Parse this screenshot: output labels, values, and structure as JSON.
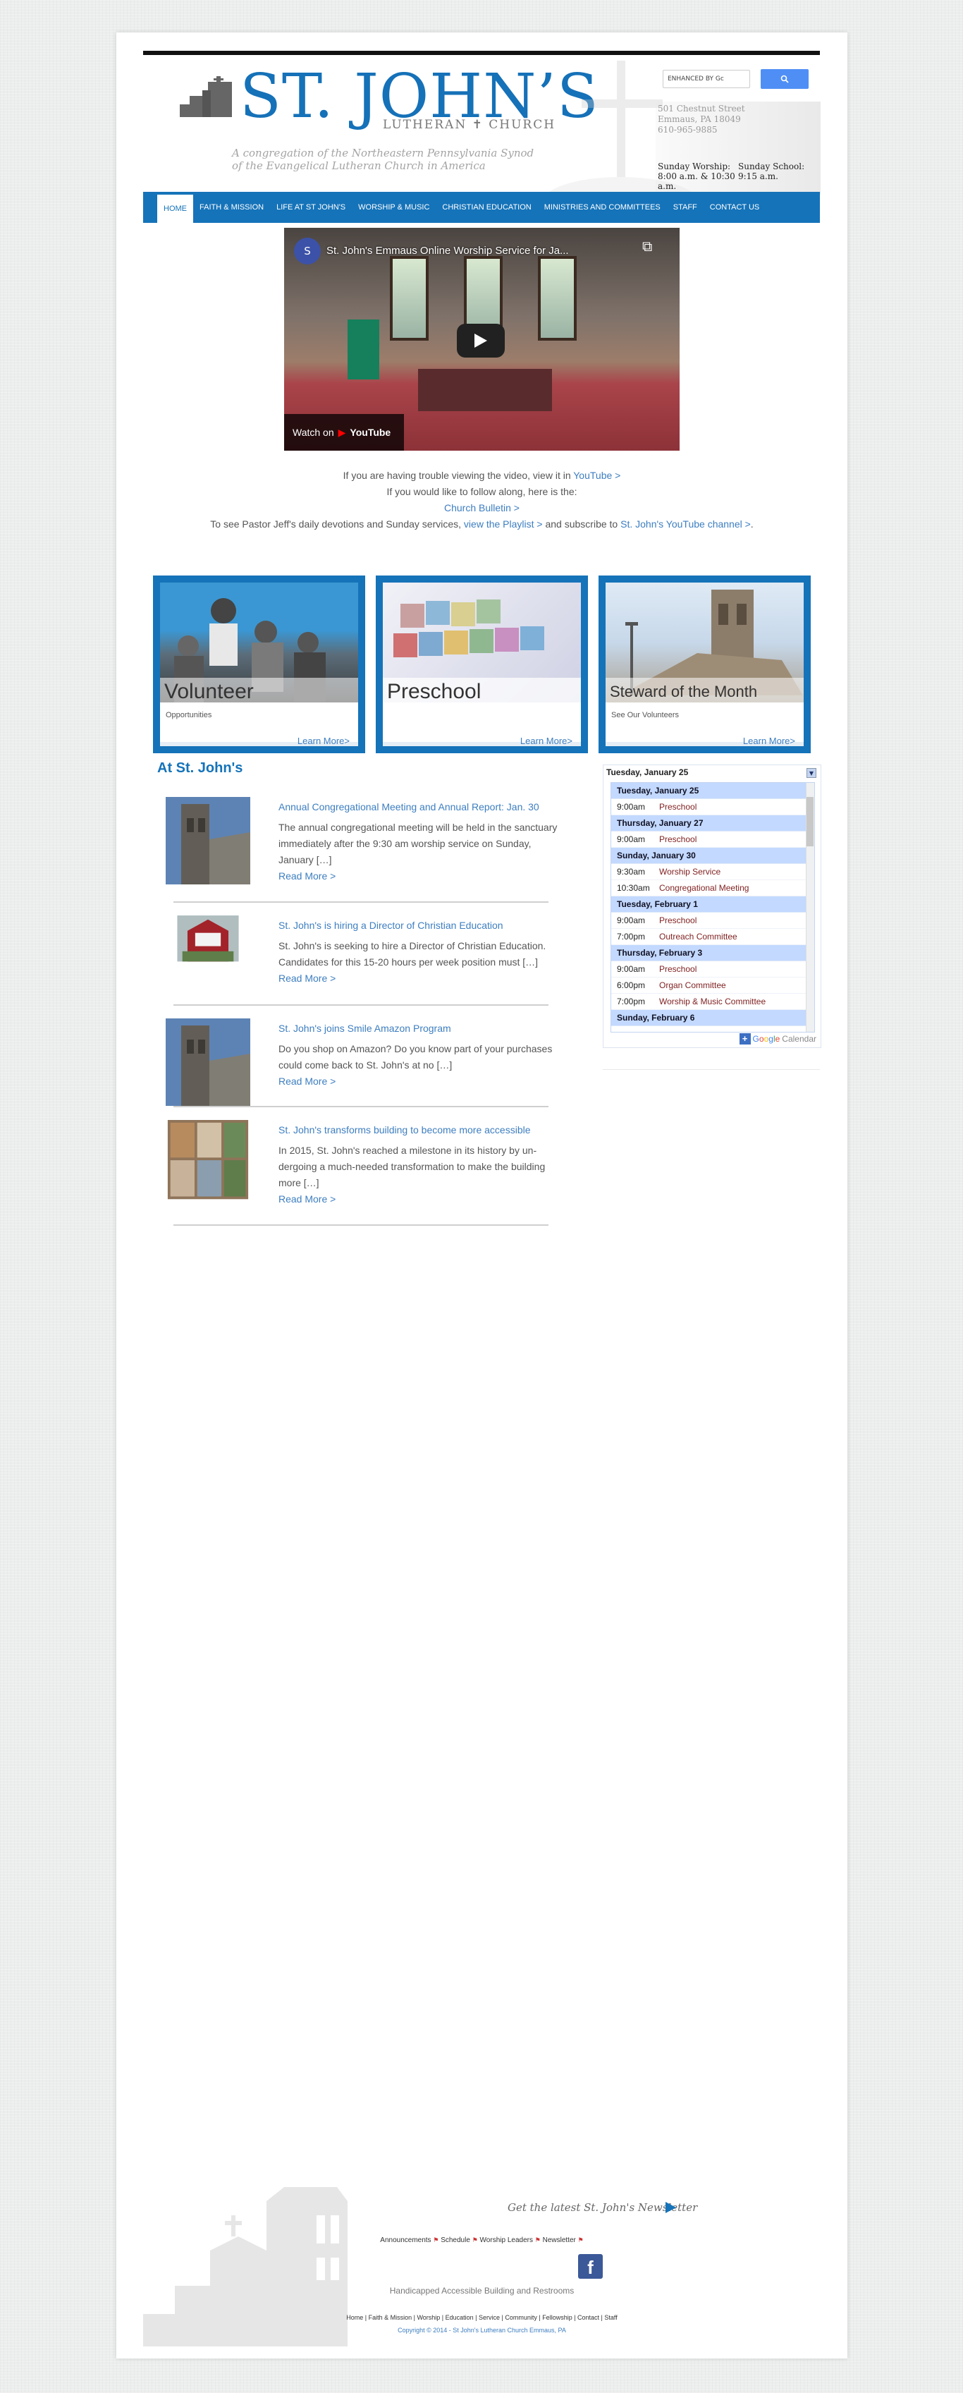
{
  "header": {
    "logo_name": "ST. JOHN’S",
    "logo_sub": "LUTHERAN ✝ CHURCH",
    "tagline": "A congregation of the Northeastern Pennsylvania Synod of the Evangelical Lutheran Church in America",
    "address": [
      "501 Chestnut Street",
      "Emmaus, PA 18049",
      "610-965-9885"
    ],
    "worship": [
      "Sunday Worship:",
      "8:00 a.m. & 10:30",
      "a.m."
    ],
    "school": [
      "Sunday School:",
      "9:15 a.m."
    ]
  },
  "search": {
    "placeholder": "ENHANCED BY Gc",
    "button_icon": "search-icon"
  },
  "nav": {
    "items": [
      "HOME",
      "FAITH & MISSION",
      "LIFE AT ST JOHN'S",
      "WORSHIP & MUSIC",
      "CHRISTIAN EDUCATION",
      "MINISTRIES AND COMMITTEES",
      "STAFF",
      "CONTACT US"
    ]
  },
  "video": {
    "avatar_letter": "S",
    "title": "St. John's Emmaus Online Worship Service for Ja...",
    "watch_on": "Watch on",
    "youtube": "YouTube"
  },
  "video_desc": {
    "line1_pre": "If you are having trouble viewing the video, view it in ",
    "line1_link": "YouTube >",
    "line2": "If you would like to follow along, here is the:",
    "line3_link": "Church Bulletin >",
    "line4_pre": "To see Pastor Jeff's daily devotions and Sunday services, ",
    "line4_link1": "view the Playlist >",
    "line4_mid": " and subscribe to ",
    "line4_link2": "St. John's YouTube channel >",
    "line4_post": "."
  },
  "features": [
    {
      "caption": "Volunteer",
      "sub": "Opportunities",
      "more": "Learn More>"
    },
    {
      "caption": "Preschool",
      "sub": "",
      "more": "Learn More>"
    },
    {
      "caption": "Steward of the Month",
      "sub": "See Our Volunteers",
      "more": "Learn More>"
    }
  ],
  "news": {
    "title": "At St. John's",
    "read_more": "Read More >",
    "items": [
      {
        "title": "Annual Congregational Meeting and Annual Report: Jan. 30",
        "excerpt": "The annual congregational meeting will be held in the sanc­tuary immediately after the 9:30 am worship service on Sunday, January […]"
      },
      {
        "title": "St. John's is hiring a Director of Christian Education",
        "excerpt": "St. John's is seeking to hire a Director of Christian Education. Candidates for this 15-20 hours per week position must […]"
      },
      {
        "title": "St. John's joins Smile Amazon Program",
        "excerpt": "Do you shop on Amazon? Do you know part of your pur­chases could come back to St. John's at no […]"
      },
      {
        "title": "St. John's transforms building to become more accessible",
        "excerpt": "In 2015, St. John's reached a milestone in its history by un­dergoing a much-needed transformation to make the build­ing more […]"
      }
    ]
  },
  "calendar": {
    "header": "Tuesday, January 25",
    "footer": "Calendar",
    "days": [
      {
        "date": "Tuesday, January 25",
        "events": [
          {
            "time": "9:00am",
            "name": "Preschool"
          }
        ]
      },
      {
        "date": "Thursday, January 27",
        "events": [
          {
            "time": "9:00am",
            "name": "Preschool"
          }
        ]
      },
      {
        "date": "Sunday, January 30",
        "events": [
          {
            "time": "9:30am",
            "name": "Worship Service"
          },
          {
            "time": "10:30am",
            "name": "Congregational Meeting"
          }
        ]
      },
      {
        "date": "Tuesday, February 1",
        "events": [
          {
            "time": "9:00am",
            "name": "Preschool"
          },
          {
            "time": "7:00pm",
            "name": "Outreach Committee"
          }
        ]
      },
      {
        "date": "Thursday, February 3",
        "events": [
          {
            "time": "9:00am",
            "name": "Preschool"
          },
          {
            "time": "6:00pm",
            "name": "Organ Committee"
          },
          {
            "time": "7:00pm",
            "name": "Worship & Music Committee"
          }
        ]
      },
      {
        "date": "Sunday, February 6",
        "events": []
      }
    ]
  },
  "footer": {
    "newsletter": "Get the latest St. John's Newsletter",
    "links": [
      "Announcements",
      "Schedule",
      "Worship Leaders",
      "Newsletter"
    ],
    "accessible": "Handicapped Accessible Building and Restrooms",
    "nav": "Home | Faith & Mission | Worship | Education | Service | Community | Fellowship | Contact | Staff",
    "copyright": "Copyright © 2014 - St John's Lutheran Church Emmaus, PA"
  },
  "colors": {
    "brand_blue": "#1573b9",
    "link_blue": "#3d7ec0",
    "event_red": "#812222"
  }
}
